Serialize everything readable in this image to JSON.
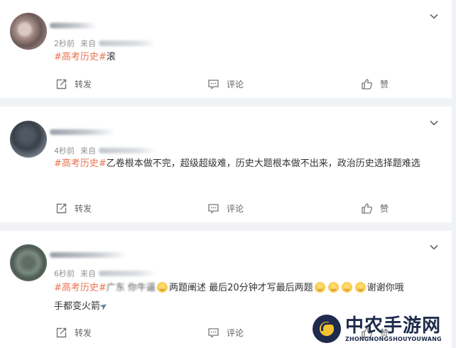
{
  "posts": [
    {
      "time": "2秒前",
      "from_label": "来自",
      "tag": "#高考历史#",
      "text": "滚",
      "actions": {
        "repost": "转发",
        "comment": "评论",
        "like": "赞"
      }
    },
    {
      "time": "4秒前",
      "from_label": "来自",
      "tag": "#高考历史#",
      "text": "乙卷根本做不完，超级超级难，历史大题根本做不出来，政治历史选择题难选",
      "actions": {
        "repost": "转发",
        "comment": "评论",
        "like": "赞"
      }
    },
    {
      "time": "6秒前",
      "from_label": "来自",
      "tag": "#高考历史#",
      "text_part1": "广东 你牛逼",
      "text_part2": "两题阐述 最后20分钟才写最后两题",
      "text_part3": "谢谢你哦",
      "text_part4": "手都变火箭",
      "actions": {
        "repost": "转发",
        "comment": "评论",
        "like": "赞"
      }
    }
  ],
  "watermark": {
    "title": "中农手游网",
    "subtitle": "ZHONGNONGSHOUYOUWANG"
  },
  "colors": {
    "tag": "#eb7350",
    "meta": "#939393",
    "background": "#f1f2f5"
  },
  "icons": [
    "chevron-down-icon",
    "repost-icon",
    "comment-icon",
    "like-icon",
    "smile-emoji-icon",
    "rocket-icon"
  ]
}
